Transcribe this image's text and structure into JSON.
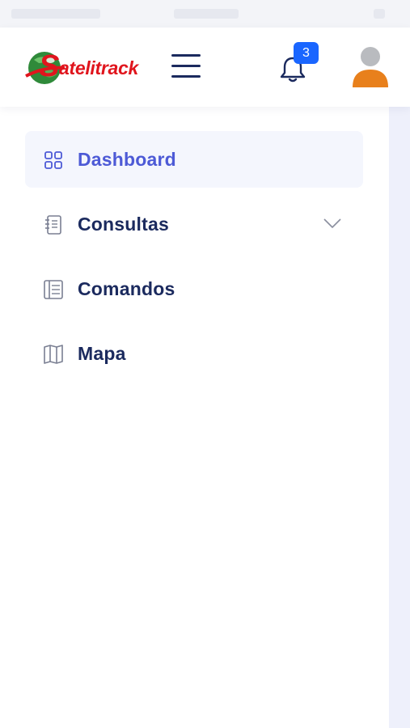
{
  "header": {
    "brand_initial": "S",
    "brand_rest": "atelitrack",
    "notification_count": "3"
  },
  "sidebar": {
    "items": [
      {
        "label": "Dashboard",
        "icon": "grid-icon",
        "active": true
      },
      {
        "label": "Consultas",
        "icon": "notebook-icon",
        "expandable": true
      },
      {
        "label": "Comandos",
        "icon": "list-panel-icon"
      },
      {
        "label": "Mapa",
        "icon": "map-icon"
      }
    ]
  },
  "colors": {
    "brand_red": "#e0151d",
    "accent": "#4d5ad6",
    "nav_text": "#1b2a5e",
    "badge": "#1a66ff",
    "avatar_body": "#e8801c"
  }
}
